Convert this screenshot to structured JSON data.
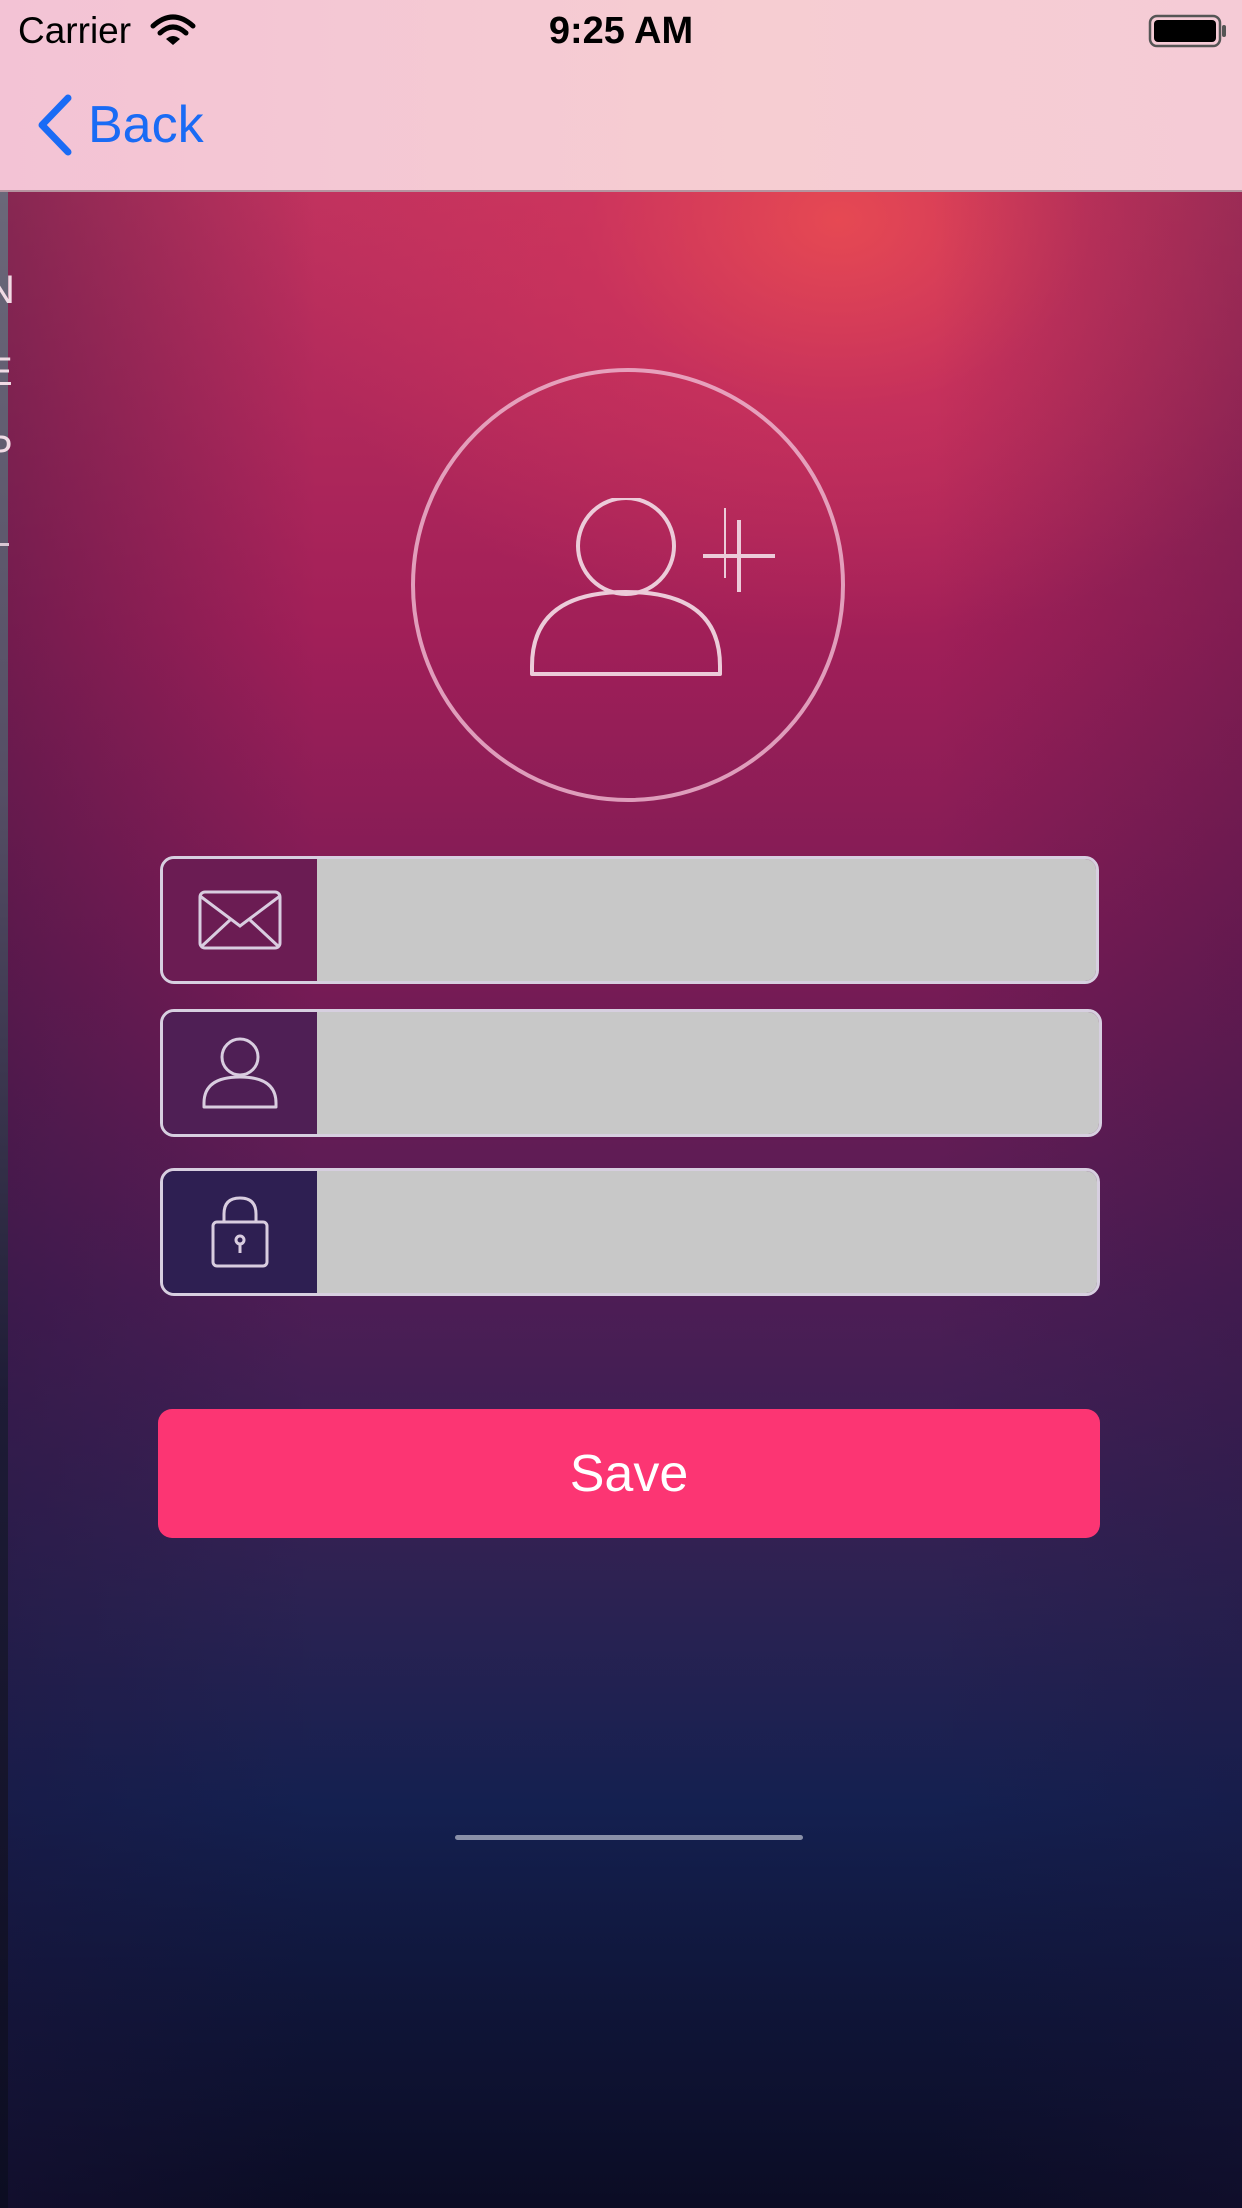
{
  "status_bar": {
    "carrier": "Carrier",
    "time": "9:25 AM",
    "wifi_icon": "wifi-icon",
    "battery_icon": "battery-full-icon"
  },
  "nav_bar": {
    "back_label": "Back",
    "back_icon": "chevron-left-icon",
    "accent_color": "#1a6bf5"
  },
  "peek_panel": {
    "letters": [
      "N",
      "E",
      "P"
    ]
  },
  "avatar": {
    "icon": "add-user-icon"
  },
  "form": {
    "email": {
      "icon": "envelope-icon",
      "value": "",
      "placeholder": ""
    },
    "username": {
      "icon": "user-icon",
      "value": "",
      "placeholder": ""
    },
    "password": {
      "icon": "lock-icon",
      "value": "",
      "placeholder": ""
    }
  },
  "actions": {
    "save_label": "Save",
    "save_color": "#fc3573"
  }
}
